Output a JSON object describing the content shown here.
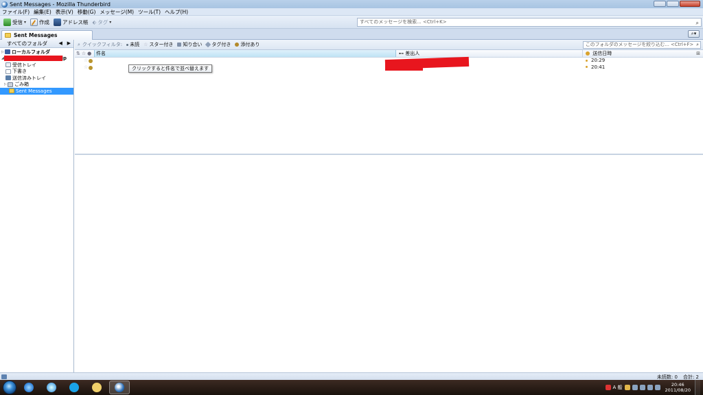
{
  "window": {
    "title": "Sent Messages - Mozilla Thunderbird"
  },
  "menu": [
    "ファイル(F)",
    "編集(E)",
    "表示(V)",
    "移動(G)",
    "メッセージ(M)",
    "ツール(T)",
    "ヘルプ(H)"
  ],
  "toolbar": {
    "get_label": "受信",
    "write_label": "作成",
    "addressbook_label": "アドレス帳",
    "tag_label": "タグ",
    "search_placeholder": "すべてのメッセージを検索... <Ctrl+K>"
  },
  "tabs": [
    {
      "label": "Sent Messages"
    }
  ],
  "folder_pane": {
    "header": "すべてのフォルダ",
    "items": [
      {
        "label": "ローカルフォルダ",
        "icon": "local-folders-icon",
        "bold": true
      },
      {
        "label": ".jp",
        "icon": "account-icon",
        "bold": true
      },
      {
        "label": "受信トレイ",
        "icon": "inbox-icon",
        "bold": false
      },
      {
        "label": "下書き",
        "icon": "drafts-icon",
        "bold": false
      },
      {
        "label": "送信済みトレイ",
        "icon": "unsent-icon",
        "bold": false
      },
      {
        "label": "ごみ箱",
        "icon": "trash-icon",
        "bold": false
      },
      {
        "label": "Sent Messages",
        "icon": "sent-folder-icon",
        "bold": false,
        "selected": true
      }
    ]
  },
  "quick_filter": {
    "label": "クイックフィルタ:",
    "unread": "未読",
    "starred": "スター付き",
    "contacts": "知り合い",
    "tags": "タグ付き",
    "attachments": "添付あり",
    "search_placeholder": "このフォルダのメッセージを絞り込む... <Ctrl+F>"
  },
  "thread_pane": {
    "columns": {
      "subject": "件名",
      "from": "差出人",
      "date": "送信日時"
    },
    "rows": [
      {
        "date": "20:29"
      },
      {
        "date": "20:41"
      }
    ],
    "tooltip": "クリックすると件名で並べ替えます"
  },
  "status_bar": {
    "unread": "未読数: 0",
    "total": "合計: 2"
  },
  "taskbar": {
    "ime": "A 般",
    "time": "20:46",
    "date": "2011/08/20"
  },
  "colors": {
    "selected_row": "#3399ff",
    "redaction": "#e8161e"
  }
}
